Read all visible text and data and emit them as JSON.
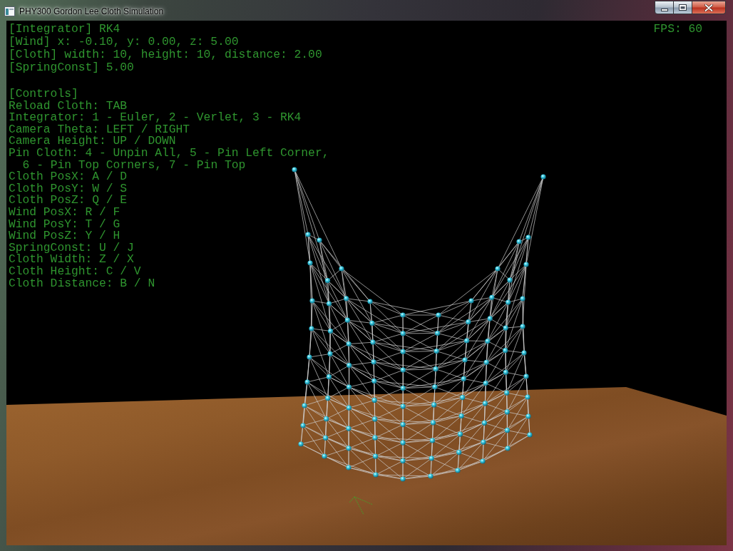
{
  "window": {
    "title": "PHY300 Gordon Lee Cloth Simulation"
  },
  "hud": {
    "status": [
      "[Integrator] RK4",
      "[Wind] x: -0.10, y: 0.00, z: 5.00",
      "[Cloth] width: 10, height: 10, distance: 2.00",
      "[SpringConst] 5.00"
    ],
    "fps": "FPS: 60",
    "controls_heading": "[Controls]",
    "controls": [
      {
        "kind": "line",
        "text": "Reload Cloth: TAB"
      },
      {
        "kind": "line",
        "text": "Integrator: 1 - Euler, 2 - Verlet, 3 - RK4"
      },
      {
        "kind": "line",
        "text": "Camera Theta: LEFT / RIGHT"
      },
      {
        "kind": "line",
        "text": "Camera Height: UP / DOWN"
      },
      {
        "kind": "line",
        "text": "Pin Cloth: 4 - Unpin All, 5 - Pin Left Corner,"
      },
      {
        "kind": "continuation",
        "text": "6 - Pin Top Corners, 7 - Pin Top"
      },
      {
        "kind": "line",
        "text": "Cloth PosX: A / D"
      },
      {
        "kind": "line",
        "text": "Cloth PosY: W / S"
      },
      {
        "kind": "line",
        "text": "Cloth PosZ: Q / E"
      },
      {
        "kind": "line",
        "text": "Wind PosX: R / F"
      },
      {
        "kind": "line",
        "text": "Wind PosY: T / G"
      },
      {
        "kind": "line",
        "text": "Wind PosZ: Y / H"
      },
      {
        "kind": "line",
        "text": "SpringConst: U / J"
      },
      {
        "kind": "line",
        "text": "Cloth Width: Z / X"
      },
      {
        "kind": "line",
        "text": "Cloth Height: C / V"
      },
      {
        "kind": "line",
        "text": "Cloth Distance: B / N"
      }
    ]
  }
}
